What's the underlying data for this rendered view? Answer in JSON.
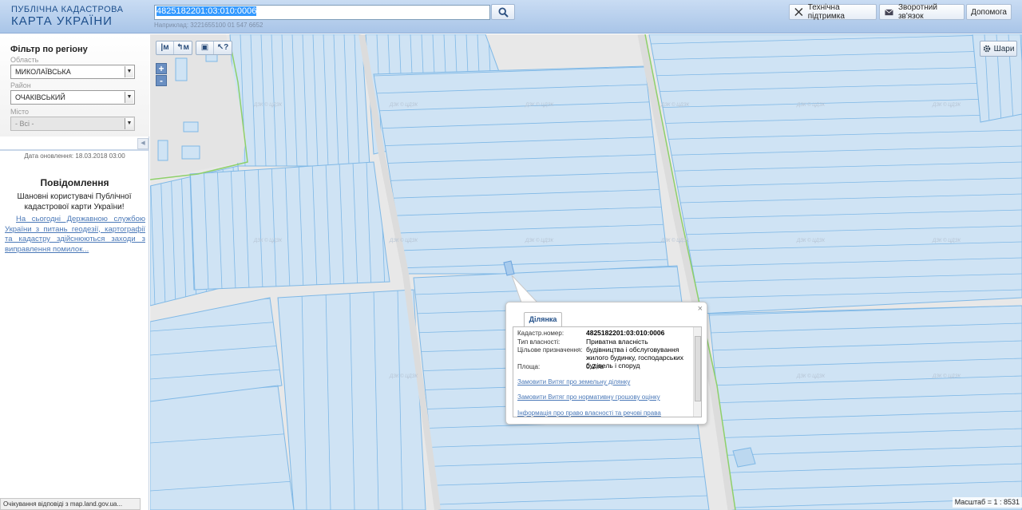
{
  "header": {
    "logo_line1": "ПУБЛІЧНА КАДАСТРОВА",
    "logo_line2": "КАРТА УКРАЇНИ",
    "search_value": "4825182201:03:010:0006",
    "search_hint": "Наприклад: 3221655100 01 547 6652",
    "support_label": "Технічна підтримка",
    "feedback_label": "Зворотний зв'язок",
    "help_label": "Допомога"
  },
  "sidebar": {
    "filter_title": "Фільтр по регіону",
    "region_label": "Область",
    "region_value": "МИКОЛАЇВСЬКА",
    "district_label": "Район",
    "district_value": "ОЧАКІВСЬКИЙ",
    "city_label": "Місто",
    "city_value": "- Всі -",
    "update_date": "Дата оновлення: 18.03.2018 03:00",
    "news_title": "Повідомлення",
    "news_greeting": "Шановні користувачі Публічної кадастрової карти України!",
    "news_body": "На сьогодні Державною службою України з питань геодезії, картографії та кадастру здійснюються заходи з виправлення помилок...",
    "status_text": "Очікування відповіді з map.land.gov.ua..."
  },
  "map": {
    "layers_label": "Шари",
    "scale_label": "Масштаб = 1 : 8531",
    "zoom_in": "+",
    "zoom_out": "-",
    "watermark": "ДЗК © ЦДЗК"
  },
  "popup": {
    "tab_label": "Ділянка",
    "close": "×",
    "cadastr_label": "Кадастр.номер:",
    "cadastr_value": "4825182201:03:010:0006",
    "ownership_label": "Тип власності:",
    "ownership_value": "Приватна власність",
    "purpose_label": "Цільове призначення:",
    "purpose_value": "будівництва і обслуговування жилого будинку, господарських будівель і споруд",
    "area_label": "Площа:",
    "area_value": "0.2 га",
    "link1": "Замовити Витяг про земельну ділянку",
    "link2": "Замовити Витяг про нормативну грошову оцінку",
    "link3": "Інформація про право власності та речові права"
  },
  "colors": {
    "parcel_fill": "#cfe3f4",
    "parcel_stroke": "#7fb8e6",
    "road": "#e8e8e8",
    "boundary_green": "#8ed06a"
  }
}
